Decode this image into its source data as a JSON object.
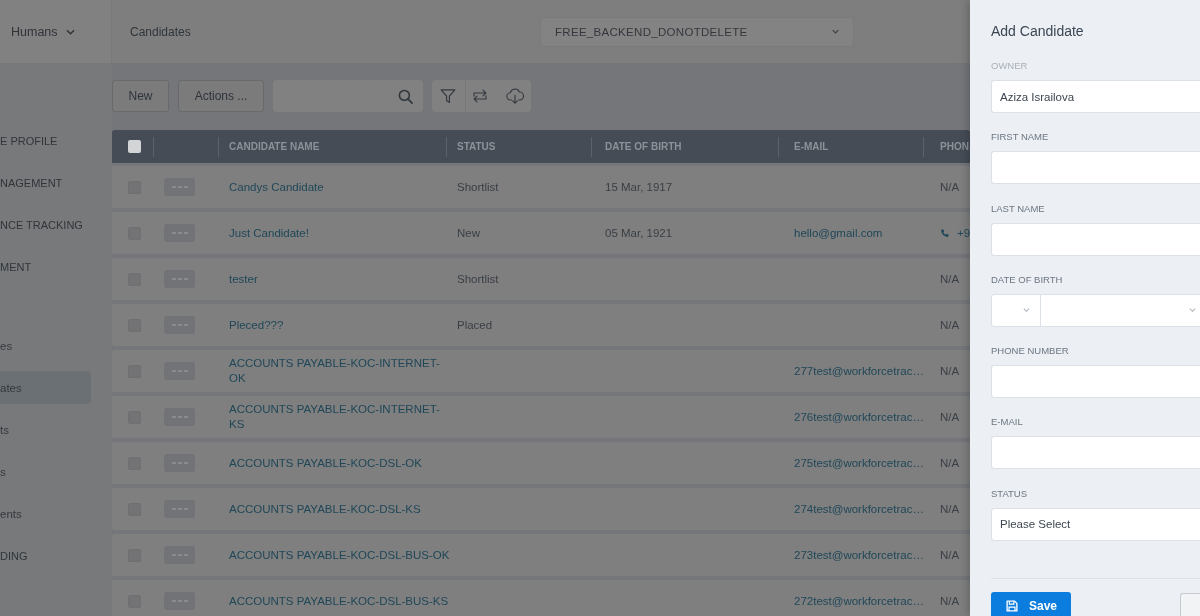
{
  "sidebar": {
    "brand": {
      "label": "Humans"
    },
    "items": [
      {
        "label": "E PROFILE",
        "kind": "section",
        "selected": false
      },
      {
        "label": "NAGEMENT",
        "kind": "section",
        "selected": false
      },
      {
        "label": "NCE TRACKING",
        "kind": "section",
        "selected": false
      },
      {
        "label": "MENT",
        "kind": "section",
        "selected": false
      },
      {
        "label": "es",
        "kind": "link",
        "selected": false
      },
      {
        "label": "ates",
        "kind": "link",
        "selected": true
      },
      {
        "label": "ts",
        "kind": "link",
        "selected": false
      },
      {
        "label": "s",
        "kind": "link",
        "selected": false
      },
      {
        "label": "ents",
        "kind": "link",
        "selected": false
      },
      {
        "label": "DING",
        "kind": "section",
        "selected": false
      }
    ]
  },
  "header": {
    "title": "Candidates",
    "workspace": "FREE_BACKEND_DONOTDELETE"
  },
  "toolbar": {
    "buttons": [
      "New",
      "Actions ..."
    ]
  },
  "table": {
    "header_checkbox": {
      "checked": false
    },
    "columns": [
      "CANDIDATE NAME",
      "STATUS",
      "DATE OF BIRTH",
      "E-MAIL",
      "PHON"
    ],
    "rows": [
      {
        "checked": false,
        "name": "Candys Candidate",
        "status": "Shortlist",
        "date_of_birth": "15 Mar, 1917",
        "phone": "N/A",
        "phone_linked": false
      },
      {
        "checked": false,
        "name": "Just Candidate!",
        "status": "New",
        "date_of_birth": "05 Mar, 1921",
        "email": "hello@gmail.com",
        "phone": "+9",
        "phone_linked": true
      },
      {
        "checked": false,
        "name": "tester",
        "status": "Shortlist",
        "phone": "N/A",
        "phone_linked": false
      },
      {
        "checked": false,
        "name": "Pleced???",
        "status": "Placed",
        "phone": "N/A",
        "phone_linked": false
      },
      {
        "checked": false,
        "name": "ACCOUNTS PAYABLE-KOC-INTERNET-OK",
        "email": "277test@workforcetrac…",
        "phone": "N/A",
        "phone_linked": false
      },
      {
        "checked": false,
        "name": "ACCOUNTS PAYABLE-KOC-INTERNET-KS",
        "email": "276test@workforcetrac…",
        "phone": "N/A",
        "phone_linked": false
      },
      {
        "checked": false,
        "name": "ACCOUNTS PAYABLE-KOC-DSL-OK",
        "email": "275test@workforcetrac…",
        "phone": "N/A",
        "phone_linked": false
      },
      {
        "checked": false,
        "name": "ACCOUNTS PAYABLE-KOC-DSL-KS",
        "email": "274test@workforcetrac…",
        "phone": "N/A",
        "phone_linked": false
      },
      {
        "checked": false,
        "name": "ACCOUNTS PAYABLE-KOC-DSL-BUS-OK",
        "email": "273test@workforcetrac…",
        "phone": "N/A",
        "phone_linked": false
      },
      {
        "checked": false,
        "name": "ACCOUNTS PAYABLE-KOC-DSL-BUS-KS",
        "email": "272test@workforcetrac…",
        "phone": "N/A",
        "phone_linked": false
      }
    ]
  },
  "drawer": {
    "title": "Add Candidate",
    "fields": [
      {
        "label": "OWNER",
        "kind": "text",
        "disabled": true,
        "value": "Aziza Israilova"
      },
      {
        "label": "FIRST NAME",
        "kind": "text",
        "disabled": false
      },
      {
        "label": "LAST NAME",
        "kind": "text",
        "disabled": false
      },
      {
        "label": "DATE OF BIRTH",
        "kind": "date",
        "disabled": false
      },
      {
        "label": "PHONE NUMBER",
        "kind": "text",
        "disabled": false
      },
      {
        "label": "E-MAIL",
        "kind": "text",
        "disabled": false
      },
      {
        "label": "STATUS",
        "kind": "select",
        "disabled": false,
        "value": "Please Select"
      }
    ],
    "buttons": [
      {
        "kind": "primary",
        "label": "Save"
      },
      {
        "kind": "secondary"
      }
    ]
  }
}
